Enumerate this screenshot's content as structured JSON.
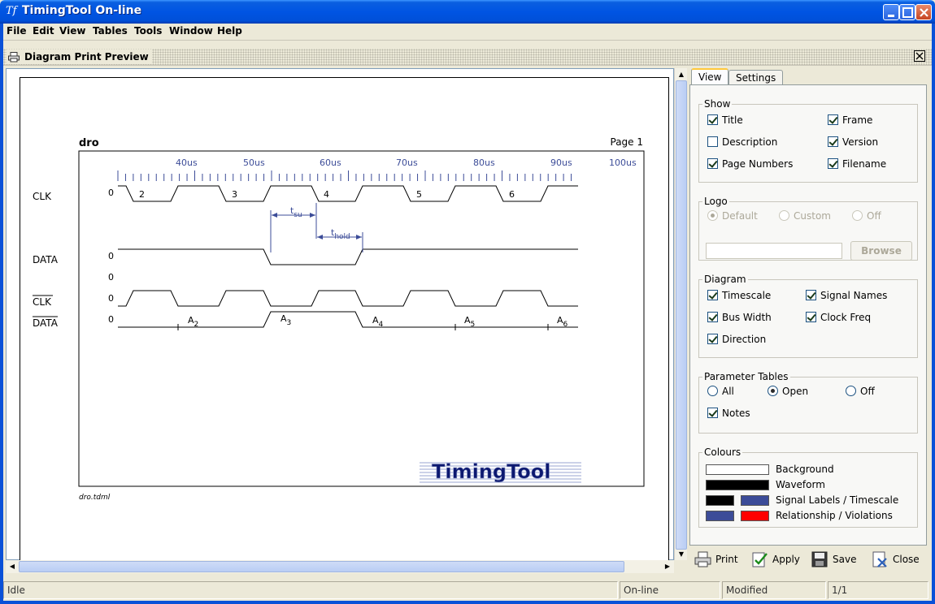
{
  "window": {
    "app_icon": "Tf",
    "title": "TimingTool On-line"
  },
  "menu": [
    "File",
    "Edit",
    "View",
    "Tables",
    "Tools",
    "Window",
    "Help"
  ],
  "internal_frame": {
    "title": "Diagram Print Preview"
  },
  "diagram": {
    "title": "dro",
    "page_label": "Page 1",
    "filename": "dro.tdml",
    "ticks": [
      "40us",
      "50us",
      "60us",
      "70us",
      "80us",
      "90us",
      "100us"
    ],
    "signals": [
      {
        "name": "CLK",
        "overline": false,
        "initial": "0"
      },
      {
        "name": "DATA",
        "overline": false,
        "initial": "0"
      },
      {
        "name": "",
        "overline": false,
        "initial": "0"
      },
      {
        "name": "CLK",
        "overline": true,
        "initial": "0"
      },
      {
        "name": "DATA",
        "overline": true,
        "initial": "0"
      }
    ],
    "clk_labels": [
      "2",
      "3",
      "4",
      "5",
      "6"
    ],
    "bus_labels": [
      {
        "base": "A",
        "sub": "2"
      },
      {
        "base": "A",
        "sub": "3"
      },
      {
        "base": "A",
        "sub": "4"
      },
      {
        "base": "A",
        "sub": "5"
      },
      {
        "base": "A",
        "sub": "6"
      }
    ],
    "t_su": {
      "base": "t",
      "sub": "su"
    },
    "t_hold": {
      "base": "t",
      "sub": "hold"
    },
    "logo": "TimingTool"
  },
  "tabs": [
    "View",
    "Settings"
  ],
  "show": {
    "legend": "Show",
    "items": [
      {
        "label": "Title",
        "checked": true
      },
      {
        "label": "Frame",
        "checked": true
      },
      {
        "label": "Description",
        "checked": false
      },
      {
        "label": "Version",
        "checked": true
      },
      {
        "label": "Page Numbers",
        "checked": true
      },
      {
        "label": "Filename",
        "checked": true
      }
    ]
  },
  "logo": {
    "legend": "Logo",
    "options": [
      {
        "label": "Default",
        "selected": true
      },
      {
        "label": "Custom",
        "selected": false
      },
      {
        "label": "Off",
        "selected": false
      }
    ],
    "path_value": "",
    "browse_label": "Browse"
  },
  "diagram_opts": {
    "legend": "Diagram",
    "items": [
      {
        "label": "Timescale",
        "checked": true
      },
      {
        "label": "Signal Names",
        "checked": true
      },
      {
        "label": "Bus Width",
        "checked": true
      },
      {
        "label": "Clock Freq",
        "checked": true
      },
      {
        "label": "Direction",
        "checked": true
      }
    ]
  },
  "param_tables": {
    "legend": "Parameter Tables",
    "options": [
      {
        "label": "All",
        "selected": false
      },
      {
        "label": "Open",
        "selected": true
      },
      {
        "label": "Off",
        "selected": false
      }
    ],
    "notes_label": "Notes",
    "notes_checked": true
  },
  "colours": {
    "legend": "Colours",
    "rows": [
      {
        "label": "Background",
        "colors": [
          "#ffffff"
        ]
      },
      {
        "label": "Waveform",
        "colors": [
          "#000000"
        ]
      },
      {
        "label": "Signal Labels / Timescale",
        "colors": [
          "#000000",
          "#3c4c98"
        ]
      },
      {
        "label": "Relationship / Violations",
        "colors": [
          "#3c4c98",
          "#ff0000"
        ]
      }
    ]
  },
  "actions": {
    "print": "Print",
    "apply": "Apply",
    "save": "Save",
    "close": "Close"
  },
  "status": {
    "state": "Idle",
    "mode": "On-line",
    "modified": "Modified",
    "page": "1/1"
  },
  "style": {
    "accent_blue": "#3c4c98",
    "violation_red": "#ff0000"
  }
}
